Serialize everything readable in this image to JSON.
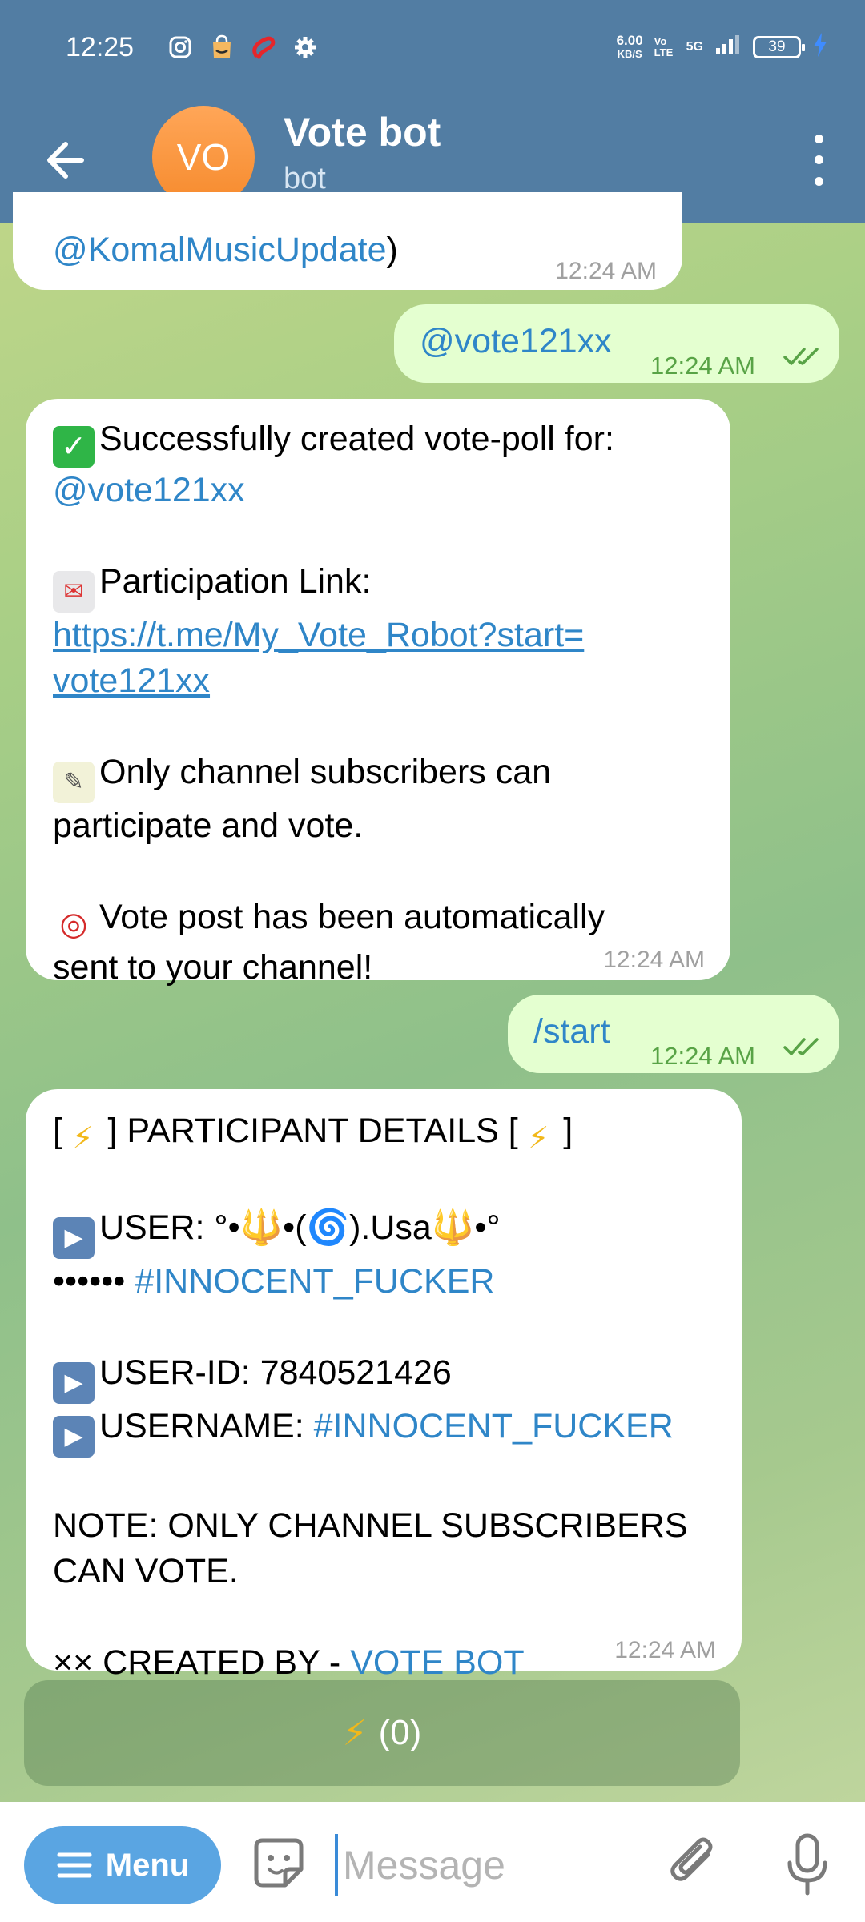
{
  "status_bar": {
    "time": "12:25",
    "net_speed_value": "6.00",
    "net_speed_unit": "KB/S",
    "volte": "Vo LTE",
    "network": "5G",
    "battery": "39"
  },
  "header": {
    "avatar_initials": "VO",
    "title": "Vote bot",
    "subtitle": "bot"
  },
  "messages": {
    "m1": {
      "link": "@KomalMusicUpdate",
      "suffix": ")",
      "time": "12:24 AM"
    },
    "m2": {
      "text": "@vote121xx",
      "time": "12:24 AM"
    },
    "m3": {
      "line1": "Successfully created vote-poll for:",
      "line1_link": "@vote121xx",
      "line2_label": "Participation Link:",
      "line2_url_a": "https://t.me/My_Vote_Robot?start=",
      "line2_url_b": "vote121xx",
      "line3_a": "Only channel subscribers can",
      "line3_b": "participate and vote.",
      "line4_a": "Vote post has been automatically",
      "line4_b": "sent to your channel!",
      "time": "12:24 AM"
    },
    "m4": {
      "text": "/start",
      "time": "12:24 AM"
    },
    "m5": {
      "header_a": "[ ",
      "header_mid": " ] PARTICIPANT DETAILS [ ",
      "header_b": " ]",
      "user_label": "USER:",
      "user_value": "°•🔱•(🌀).Usa🔱•°",
      "user_dots": "•••••• ",
      "user_tag": "#INNOCENT_FUCKER",
      "userid_label": "USER-ID:",
      "userid_value": "7840521426",
      "username_label": "USERNAME:",
      "username_value": "#INNOCENT_FUCKER",
      "note_a": "NOTE: ONLY CHANNEL SUBSCRIBERS",
      "note_b": "CAN VOTE.",
      "created_prefix": "×× CREATED BY - ",
      "created_link": "VOTE BOT",
      "time": "12:24 AM"
    }
  },
  "inline_keyboard": {
    "button_label": "(0)"
  },
  "input_bar": {
    "menu_label": "Menu",
    "placeholder": "Message"
  },
  "colors": {
    "header_bg": "#527da3",
    "incoming_bubble": "#ffffff",
    "outgoing_bubble": "#e4ffd0",
    "link": "#2f86c8",
    "menu_button": "#5aa5e2",
    "avatar": "#f68a2c"
  },
  "icons": [
    "back-arrow-icon",
    "more-vert-icon",
    "instagram-icon",
    "amazon-icon",
    "airtel-icon",
    "settings-icon",
    "signal-icon",
    "battery-icon",
    "charging-icon",
    "read-receipt-icon",
    "lightning-icon",
    "emoji-sticker-icon",
    "paperclip-icon",
    "mic-icon"
  ]
}
